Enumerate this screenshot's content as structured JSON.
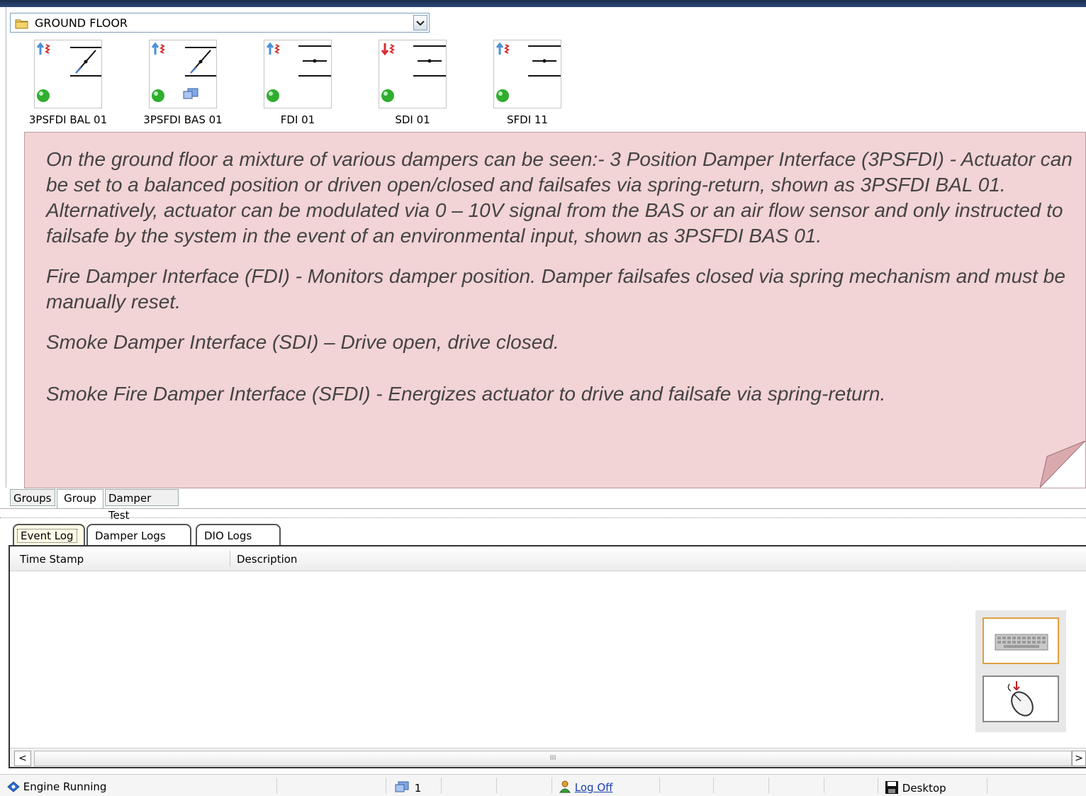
{
  "floor_selector": {
    "value": "GROUND FLOOR"
  },
  "devices": [
    {
      "label": "3PSFDI BAL 01",
      "arrow": "up",
      "symbol": "diagonal-damper",
      "extra_icon": "none"
    },
    {
      "label": "3PSFDI BAS 01",
      "arrow": "up",
      "symbol": "diagonal-damper",
      "extra_icon": "monitor-icon"
    },
    {
      "label": "FDI 01",
      "arrow": "up",
      "symbol": "horizontal-damper",
      "extra_icon": "none"
    },
    {
      "label": "SDI 01",
      "arrow": "down",
      "symbol": "horizontal-damper",
      "extra_icon": "none"
    },
    {
      "label": "SFDI 11",
      "arrow": "up",
      "symbol": "horizontal-damper",
      "extra_icon": "none"
    }
  ],
  "note": {
    "paragraphs": [
      "On the ground floor a mixture of various dampers can be seen:- 3 Position Damper Interface (3PSFDI) - Actuator can be set to a balanced position or driven open/closed and failsafes via spring-return, shown as 3PSFDI BAL 01. Alternatively, actuator can be modulated via 0 – 10V signal from the BAS or an air flow sensor and only instructed to failsafe by the system in the event of an environmental input, shown as 3PSFDI BAS 01.",
      "Fire Damper Interface (FDI) - Monitors damper position. Damper failsafes closed via spring mechanism and must be manually reset.",
      "Smoke Damper Interface (SDI) – Drive open, drive closed.",
      "Smoke Fire Damper Interface (SFDI) - Energizes actuator to drive and failsafe via spring-return."
    ]
  },
  "view_tabs": [
    "Groups",
    "Group",
    "Damper Test"
  ],
  "active_view_tab": "Group",
  "log_tabs": [
    "Event Log",
    "Damper Logs",
    "DIO Logs"
  ],
  "active_log_tab": "Event Log",
  "log_table": {
    "columns": [
      "Time Stamp",
      "Description"
    ],
    "rows": []
  },
  "scrollbar": {
    "thumb_grip": "III"
  },
  "status_bar": {
    "engine": "Engine Running",
    "count": "1",
    "logoff": "Log Off",
    "mode": "Desktop"
  },
  "colors": {
    "note_bg": "#f2d3d6",
    "status_ok": "#2fae2f",
    "arrow_up": "#4a90d9",
    "arrow_down": "#d83030"
  }
}
